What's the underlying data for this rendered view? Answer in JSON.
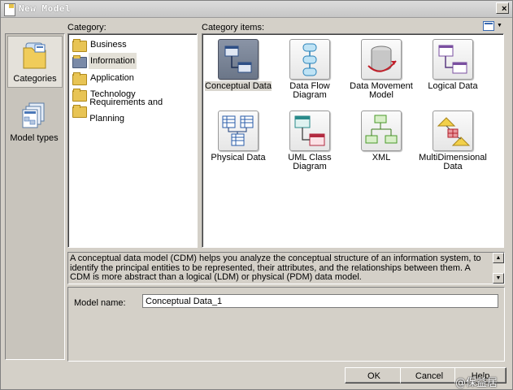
{
  "window": {
    "title": "New Model",
    "close_glyph": "×"
  },
  "left_panel": {
    "items": [
      {
        "label": "Categories",
        "icon": "categories-icon",
        "selected": true
      },
      {
        "label": "Model types",
        "icon": "model-types-icon",
        "selected": false
      }
    ]
  },
  "category_label": "Category:",
  "categories": [
    {
      "label": "Business"
    },
    {
      "label": "Information"
    },
    {
      "label": "Application"
    },
    {
      "label": "Technology"
    },
    {
      "label": "Requirements and Planning"
    }
  ],
  "category_items_label": "Category items:",
  "items": [
    {
      "label": "Conceptual Data"
    },
    {
      "label": "Data Flow Diagram"
    },
    {
      "label": "Data Movement Model"
    },
    {
      "label": "Logical Data"
    },
    {
      "label": "Physical Data"
    },
    {
      "label": "UML Class Diagram"
    },
    {
      "label": "XML"
    },
    {
      "label": "MultiDimensional Data"
    }
  ],
  "description": "A conceptual data model (CDM) helps you analyze the conceptual structure of an information system, to identify the principal entities to be represented, their attributes, and the relationships between them. A CDM is more abstract than a logical (LDM) or physical (PDM) data model.",
  "model_name": {
    "label": "Model name:",
    "value": "Conceptual Data_1"
  },
  "buttons": {
    "ok": "OK",
    "cancel": "Cancel",
    "help": "Help"
  },
  "watermark": "@保益居",
  "colors": {
    "folder": "#e8c454",
    "selection": "#6b7688",
    "dialog_bg": "#d4d0c8"
  }
}
